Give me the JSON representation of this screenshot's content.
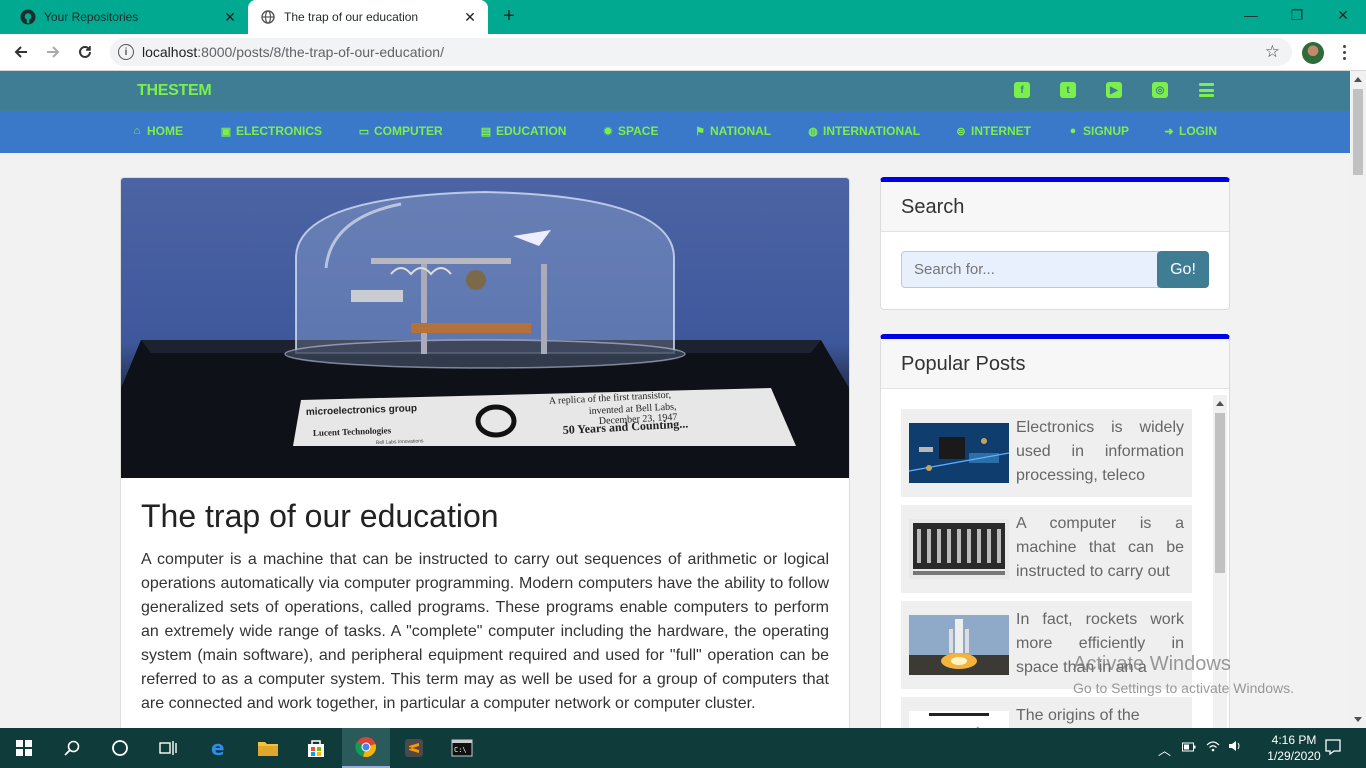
{
  "browser": {
    "tabs": [
      {
        "label": "Your Repositories",
        "active": false,
        "icon": "github-icon"
      },
      {
        "label": "The trap of our education",
        "active": true,
        "icon": "globe-icon"
      }
    ],
    "new_tab": "+",
    "window_controls": {
      "minimize": "—",
      "restore": "❐",
      "close": "✕"
    },
    "url_host": "localhost",
    "url_rest": ":8000/posts/8/the-trap-of-our-education/"
  },
  "site": {
    "brand": "THESTEM",
    "social": [
      "facebook-icon",
      "twitter-icon",
      "youtube-icon",
      "instagram-icon",
      "menu-icon"
    ],
    "nav": [
      {
        "label": "HOME",
        "icon": "home-icon",
        "glyph": "⌂"
      },
      {
        "label": "ELECTRONICS",
        "icon": "chip-icon",
        "glyph": "▣"
      },
      {
        "label": "COMPUTER",
        "icon": "desktop-icon",
        "glyph": "▭"
      },
      {
        "label": "EDUCATION",
        "icon": "book-icon",
        "glyph": "▤"
      },
      {
        "label": "SPACE",
        "icon": "gear-icon",
        "glyph": "✹"
      },
      {
        "label": "NATIONAL",
        "icon": "flag-icon",
        "glyph": "⚑"
      },
      {
        "label": "INTERNATIONAL",
        "icon": "globe-icon",
        "glyph": "◍"
      },
      {
        "label": "INTERNET",
        "icon": "internet-icon",
        "glyph": "⊜"
      },
      {
        "label": "SIGNUP",
        "icon": "user-icon",
        "glyph": "●"
      },
      {
        "label": "LOGIN",
        "icon": "login-icon",
        "glyph": "➜"
      }
    ]
  },
  "post": {
    "title": "The trap of our education",
    "body": "A computer is a machine that can be instructed to carry out sequences of arithmetic or logical operations automatically via computer programming. Modern computers have the ability to follow generalized sets of operations, called programs. These programs enable computers to perform an extremely wide range of tasks. A \"complete\" computer including the hardware, the operating system (main software), and peripheral equipment required and used for \"full\" operation can be referred to as a computer system. This term may as well be used for a group of computers that are connected and work together, in particular a computer network or computer cluster.",
    "hero_text": {
      "plaque_left": "microelectronics group",
      "plaque_company": "Lucent Technologies",
      "plaque_sub": "Bell Labs Innovations",
      "plaque_right_1": "A replica of the first transistor,",
      "plaque_right_2": "invented at Bell Labs,",
      "plaque_right_3": "December 23, 1947",
      "plaque_right_4": "50 Years and Counting..."
    }
  },
  "sidebar": {
    "search": {
      "title": "Search",
      "placeholder": "Search for...",
      "button": "Go!"
    },
    "popular": {
      "title": "Popular Posts",
      "items": [
        {
          "text": "Electronics is widely used in information processing, teleco"
        },
        {
          "text": "A computer is a machine that can be instructed to carry out"
        },
        {
          "text": "In fact, rockets work more efficiently in space than in an a"
        },
        {
          "text": "The origins of the"
        }
      ]
    }
  },
  "watermark": {
    "line1": "Activate Windows",
    "line2": "Go to Settings to activate Windows."
  },
  "taskbar": {
    "time": "4:16 PM",
    "date": "1/29/2020"
  }
}
